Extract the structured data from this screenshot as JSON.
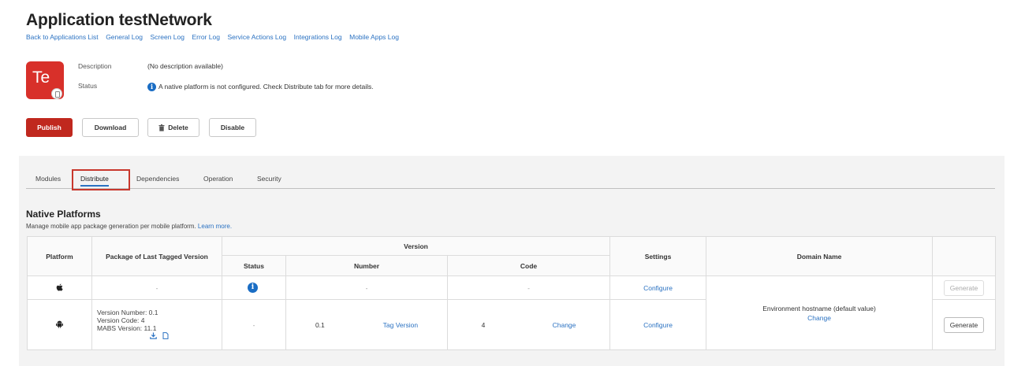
{
  "app": {
    "title": "Application testNetwork",
    "icon_initials": "Te",
    "icon_color": "#d8302a"
  },
  "links": [
    "Back to Applications List",
    "General Log",
    "Screen Log",
    "Error Log",
    "Service Actions Log",
    "Integrations Log",
    "Mobile Apps Log"
  ],
  "meta": {
    "description_label": "Description",
    "description_value": "(No description available)",
    "status_label": "Status",
    "status_value": "A native platform is not configured. Check Distribute tab for more details."
  },
  "actions": {
    "publish": "Publish",
    "download": "Download",
    "delete": "Delete",
    "disable": "Disable"
  },
  "tabs": [
    "Modules",
    "Distribute",
    "Dependencies",
    "Operation",
    "Security"
  ],
  "active_tab": "Distribute",
  "native": {
    "title": "Native Platforms",
    "subtitle": "Manage mobile app package generation per mobile platform.",
    "learn_more": "Learn more."
  },
  "table": {
    "headers": {
      "platform": "Platform",
      "package": "Package of Last Tagged Version",
      "version": "Version",
      "status": "Status",
      "number": "Number",
      "code": "Code",
      "settings": "Settings",
      "domain": "Domain Name"
    },
    "ios": {
      "package": "-",
      "number": "-",
      "code": "-",
      "settings": "Configure",
      "generate": "Generate"
    },
    "android": {
      "package_version_number": "Version Number: 0.1",
      "package_version_code": "Version Code: 4",
      "package_mabs": "MABS Version: 11.1",
      "status": "-",
      "number": "0.1",
      "tag_version": "Tag Version",
      "code": "4",
      "change_code": "Change",
      "settings": "Configure",
      "domain": "Environment hostname (default value)",
      "domain_change": "Change",
      "generate": "Generate"
    }
  },
  "colors": {
    "accent": "#2b72c2",
    "primary_button": "#c0281e",
    "info": "#1a6dc4"
  }
}
